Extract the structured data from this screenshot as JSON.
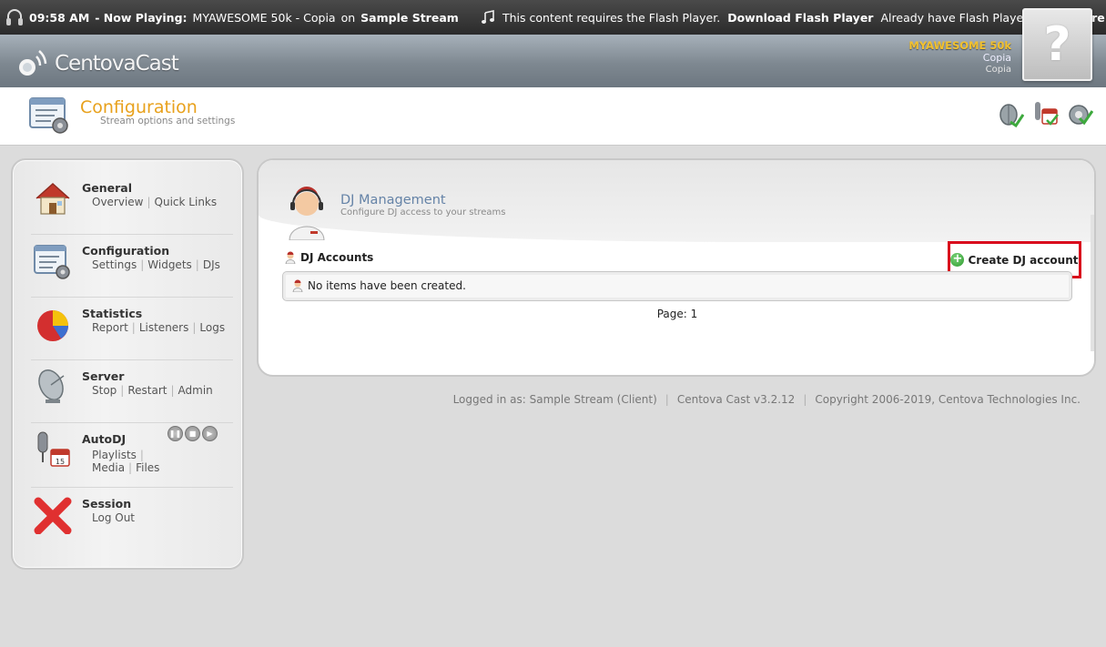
{
  "topbar": {
    "time": "09:58 AM",
    "now_playing_label": "- Now Playing:",
    "track": "MYAWESOME 50k - Copia",
    "on": "on",
    "stream": "Sample Stream",
    "flash_msg": "This content requires the Flash Player.",
    "download_flash": "Download Flash Player",
    "already": "Already have Flash Player?",
    "click_here": "Click here."
  },
  "brand": {
    "logo": "CentovaCast",
    "station_name": "MYAWESOME 50k",
    "line1": "Copia",
    "line2": "Copia",
    "coverart_glyph": "?"
  },
  "section": {
    "title": "Configuration",
    "subtitle": "Stream options and settings"
  },
  "sidebar": {
    "items": [
      {
        "title": "General",
        "links": [
          "Overview",
          "Quick Links"
        ]
      },
      {
        "title": "Configuration",
        "links": [
          "Settings",
          "Widgets",
          "DJs"
        ]
      },
      {
        "title": "Statistics",
        "links": [
          "Report",
          "Listeners",
          "Logs"
        ]
      },
      {
        "title": "Server",
        "links": [
          "Stop",
          "Restart",
          "Admin"
        ]
      },
      {
        "title": "AutoDJ",
        "links": [
          "Playlists",
          "Media",
          "Files"
        ]
      },
      {
        "title": "Session",
        "links": [
          "Log Out"
        ]
      }
    ]
  },
  "panel": {
    "title": "DJ Management",
    "subtitle": "Configure DJ access to your streams",
    "accounts_label": "DJ Accounts",
    "create_label": "Create DJ account",
    "empty_msg": "No items have been created.",
    "page_label": "Page: 1"
  },
  "footer": {
    "logged_in": "Logged in as: Sample Stream (Client)",
    "version": "Centova Cast v3.2.12",
    "copyright": "Copyright 2006-2019, Centova Technologies Inc."
  },
  "colors": {
    "accent_orange": "#e8a11c",
    "station_yellow": "#f2c12e",
    "highlight_red": "#d9091c",
    "panel_title_blue": "#6583a7"
  }
}
